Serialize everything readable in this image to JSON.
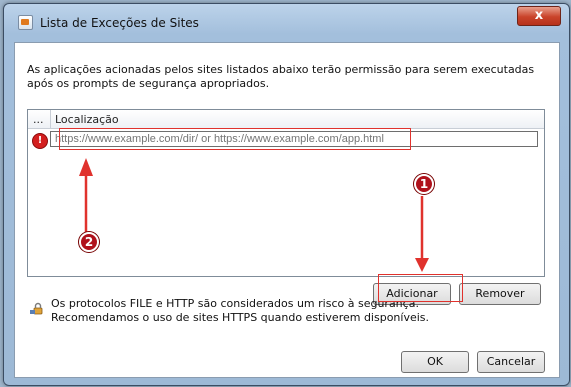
{
  "window": {
    "title": "Lista de Exceções de Sites",
    "close_label": "x"
  },
  "description": "As aplicações acionadas pelos sites listados abaixo terão permissão para serem executadas após os prompts de segurança apropriados.",
  "table": {
    "columns": [
      "...",
      "Localização"
    ],
    "rows": [
      {
        "status_icon": "warning-icon",
        "url_placeholder": "https://www.example.com/dir/ or https://www.example.com/app.html"
      }
    ]
  },
  "buttons": {
    "add": "Adicionar",
    "remove": "Remover",
    "ok": "OK",
    "cancel": "Cancelar"
  },
  "info": {
    "icon": "lock-icon",
    "line1": "Os protocolos FILE e HTTP são considerados um risco à segurança.",
    "line2": "Recomendamos o uso de sites HTTPS quando estiverem disponíveis."
  },
  "annotations": {
    "badge1": "1",
    "badge2": "2",
    "highlight_color": "#e0322d",
    "badge_color": "#b0111b"
  }
}
